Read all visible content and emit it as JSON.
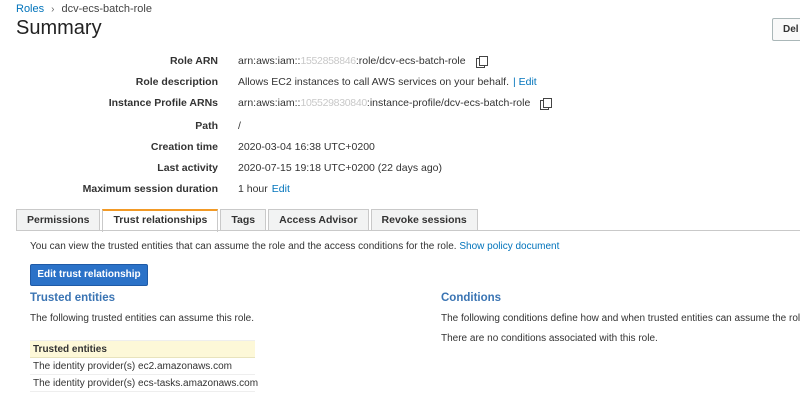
{
  "breadcrumb": {
    "root": "Roles",
    "separator": "›",
    "current": "dcv-ecs-batch-role"
  },
  "page": {
    "title": "Summary",
    "delete_label": "Del"
  },
  "summary": [
    {
      "label": "Role ARN",
      "value_prefix": "arn:aws:iam::",
      "value_masked": "1552858846",
      "value_suffix": ":role/dcv-ecs-batch-role",
      "copy_icon": "copy-icon"
    },
    {
      "label": "Role description",
      "value": "Allows EC2 instances to call AWS services on your behalf.",
      "link": "| Edit"
    },
    {
      "label": "Instance Profile ARNs",
      "value_prefix": "arn:aws:iam::",
      "value_masked": "105529830840",
      "value_suffix": ":instance-profile/dcv-ecs-batch-role",
      "copy_icon": "copy-icon"
    },
    {
      "label": "Path",
      "value": "/"
    },
    {
      "label": "Creation time",
      "value": "2020-03-04 16:38 UTC+0200"
    },
    {
      "label": "Last activity",
      "value": "2020-07-15 19:18 UTC+0200 (22 days ago)"
    },
    {
      "label": "Maximum session duration",
      "value": "1 hour",
      "link": "Edit"
    }
  ],
  "tabs": [
    "Permissions",
    "Trust relationships",
    "Tags",
    "Access Advisor",
    "Revoke sessions"
  ],
  "active_tab": "Trust relationships",
  "trust": {
    "intro": "You can view the trusted entities that can assume the role and the access conditions for the role.",
    "intro_link": "Show policy document",
    "edit_button": "Edit trust relationship",
    "trusted_heading": "Trusted entities",
    "trusted_text": "The following trusted entities can assume this role.",
    "table_header": "Trusted entities",
    "rows": [
      "The identity provider(s) ec2.amazonaws.com",
      "The identity provider(s) ecs-tasks.amazonaws.com"
    ],
    "conditions_heading": "Conditions",
    "conditions_text": "The following conditions define how and when trusted entities can assume the role.",
    "conditions_none": "There are no conditions associated with this role."
  },
  "colors": {
    "link": "#0073bb",
    "primary_button": "#2b72c8",
    "active_tab_accent": "#f29a26",
    "section_heading": "#3a74b3",
    "table_header_bg": "#fdf8d8"
  }
}
